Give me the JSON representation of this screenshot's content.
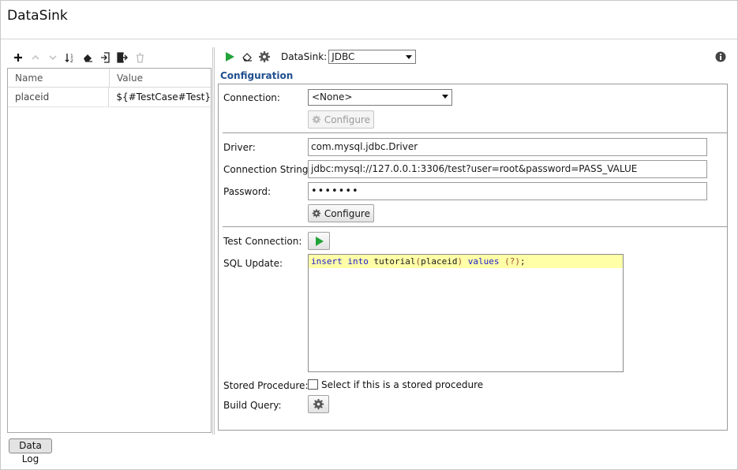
{
  "window": {
    "title": "DataSink"
  },
  "left_panel": {
    "toolbar": [
      "add-icon",
      "move-up-icon",
      "move-down-icon",
      "sort-icon",
      "clear-icon",
      "import-icon",
      "export-icon",
      "delete-icon"
    ],
    "columns": {
      "name": "Name",
      "value": "Value"
    },
    "rows": [
      {
        "name": "placeid",
        "value": "${#TestCase#Test}"
      }
    ]
  },
  "right_panel": {
    "toolbar": {
      "run": "run-icon",
      "clear": "clear-icon",
      "settings": "gear-icon"
    },
    "datasink_label": "DataSink:",
    "datasink_value": "JDBC",
    "section_title": "Configuration",
    "connection_label": "Connection:",
    "connection_value": "<None>",
    "configure_disabled_label": "Configure",
    "driver_label": "Driver:",
    "driver_value": "com.mysql.jdbc.Driver",
    "connection_string_label": "Connection String:",
    "connection_string_value": "jdbc:mysql://127.0.0.1:3306/test?user=root&password=PASS_VALUE",
    "password_label": "Password:",
    "password_value": "•••••••",
    "configure_label": "Configure",
    "test_connection_label": "Test Connection:",
    "sql_update_label": "SQL Update:",
    "sql": {
      "kw_insert": "insert",
      "kw_into": "into",
      "table": "tutorial",
      "open_paren": "(",
      "column": "placeid",
      "close_paren": ")",
      "kw_values": "values",
      "values_expr": "(?)",
      "terminator": ";"
    },
    "stored_procedure_label": "Stored Procedure:",
    "stored_procedure_checkbox_label": "Select if this is a stored procedure",
    "stored_procedure_checked": false,
    "build_query_label": "Build Query:"
  },
  "bottom_tabs": [
    {
      "label": "Data Log"
    }
  ],
  "colors": {
    "accent": "#1f4f8f",
    "run_green": "#22a33a",
    "sql_highlight": "#ffffa8",
    "keyword_blue": "#1c1cd0"
  }
}
